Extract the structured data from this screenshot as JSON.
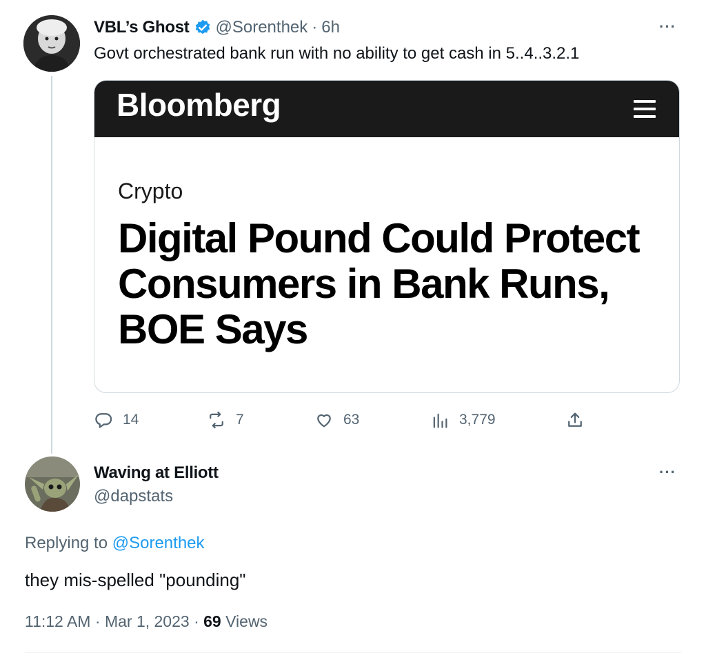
{
  "tweet": {
    "author_name": "VBL’s Ghost",
    "handle": "@Sorenthek",
    "separator": "·",
    "time": "6h",
    "more": "···",
    "text": "Govt orchestrated bank run with no ability to get cash in 5..4..3.2.1",
    "verified_color": "#1d9bf0",
    "image_card": {
      "brand": "Bloomberg",
      "kicker": "Crypto",
      "headline": "Digital Pound Could Protect Consumers in Bank Runs, BOE Says"
    },
    "actions": {
      "replies": "14",
      "retweets": "7",
      "likes": "63",
      "views": "3,779"
    }
  },
  "reply": {
    "author_name": "Waving at Elliott",
    "handle": "@dapstats",
    "more": "···",
    "replying_prefix": "Replying to",
    "replying_to": "@Sorenthek",
    "text": "they mis-spelled \"pounding\"",
    "time": "11:12 AM",
    "date": "Mar 1, 2023",
    "separator": "·",
    "views_count": "69",
    "views_label": "Views"
  }
}
